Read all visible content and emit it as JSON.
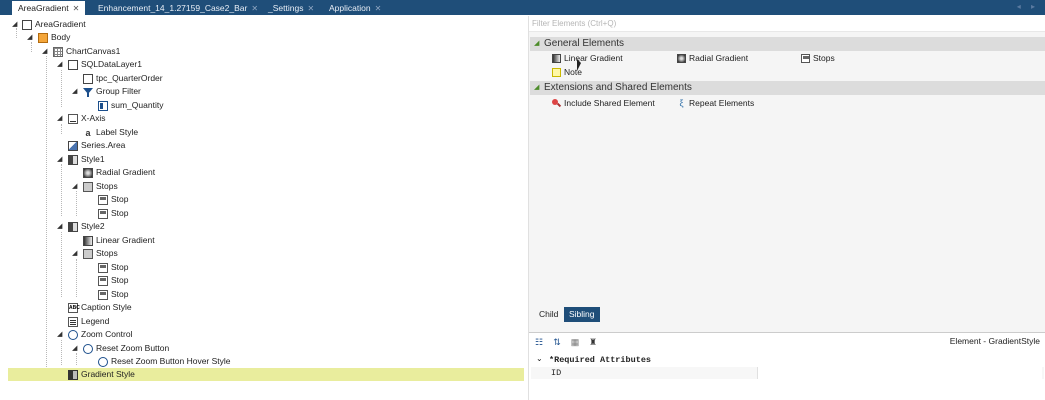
{
  "tabs": [
    {
      "label": "AreaGradient",
      "active": true
    },
    {
      "label": "Enhancement_14_1.27159_Case2_Bar",
      "active": false
    },
    {
      "label": "_Settings",
      "active": false
    },
    {
      "label": "Application",
      "active": false
    }
  ],
  "tree": {
    "root": "AreaGradient",
    "body": "Body",
    "chart_canvas": "ChartCanvas1",
    "sql_layer": "SQLDataLayer1",
    "tpc": "tpc_QuarterOrder",
    "group_filter": "Group Filter",
    "sum_qty": "sum_Quantity",
    "x_axis": "X-Axis",
    "label_style": "Label Style",
    "series_area": "Series.Area",
    "style1": "Style1",
    "radial_gradient": "Radial Gradient",
    "stops1": "Stops",
    "stop1a": "Stop",
    "stop1b": "Stop",
    "style2": "Style2",
    "linear_gradient": "Linear Gradient",
    "stops2": "Stops",
    "stop2a": "Stop",
    "stop2b": "Stop",
    "stop2c": "Stop",
    "caption_style": "Caption Style",
    "legend": "Legend",
    "zoom_control": "Zoom Control",
    "reset_zoom": "Reset Zoom Button",
    "reset_zoom_hover": "Reset Zoom Button Hover Style",
    "gradient_style": "Gradient Style"
  },
  "filter": {
    "placeholder": "Filter Elements (Ctrl+Q)"
  },
  "groups": {
    "general": "General Elements",
    "extensions": "Extensions and Shared Elements"
  },
  "elements": {
    "linear_gradient": "Linear Gradient",
    "radial_gradient": "Radial Gradient",
    "stops": "Stops",
    "note": "Note",
    "include_shared": "Include Shared Element",
    "repeat_elements": "Repeat Elements"
  },
  "toggle": {
    "child": "Child",
    "sibling": "Sibling"
  },
  "attributes": {
    "title": "Element - GradientStyle",
    "group": "*Required Attributes",
    "id_label": "ID",
    "id_value": ""
  },
  "colors": {
    "tab_bar": "#1f4e79",
    "selection": "#e9ed9d",
    "sibling_active": "#1f4e79"
  }
}
